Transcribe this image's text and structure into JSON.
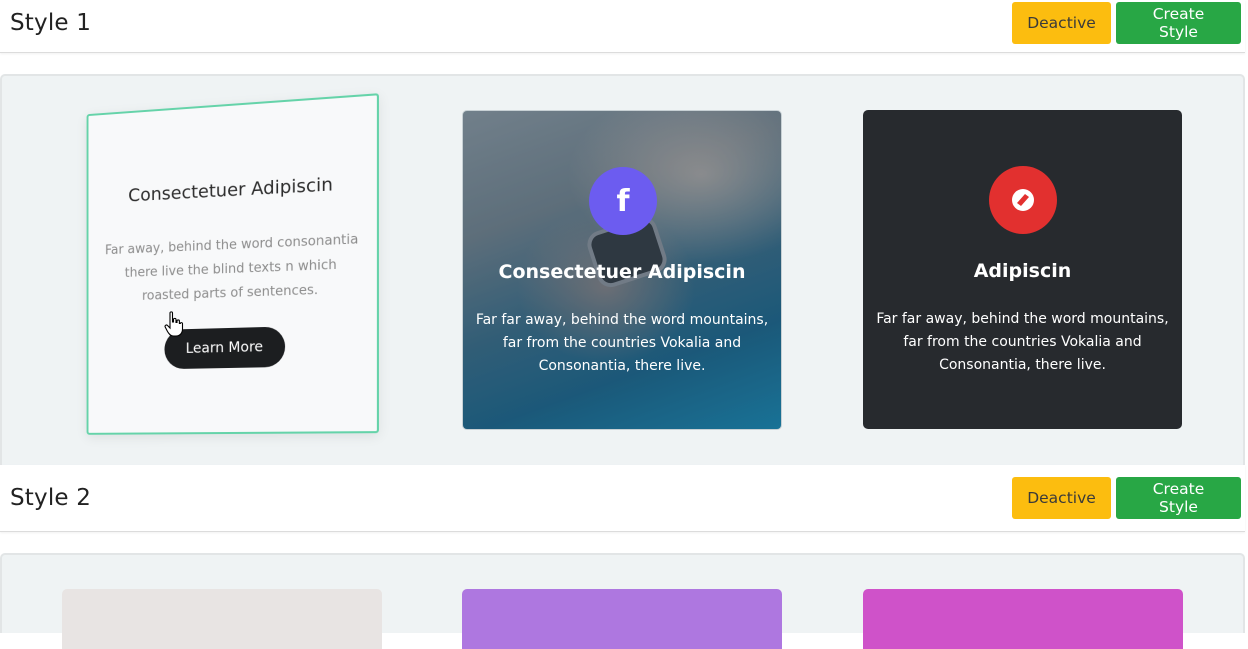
{
  "sections": [
    {
      "title": "Style 1",
      "deactive_label": "Deactive",
      "create_label": "Create Style"
    },
    {
      "title": "Style 2",
      "deactive_label": "Deactive",
      "create_label": "Create Style"
    }
  ],
  "style1_cards": [
    {
      "title": "Consectetuer Adipiscin",
      "text": "Far away, behind the word consonantia there live the blind texts n which roasted parts of sentences.",
      "button_label": "Learn More",
      "border_color": "#65d3a9"
    },
    {
      "title": "Consectetuer Adipiscin",
      "text": "Far far away, behind the word mountains, far from the countries Vokalia and Consonantia, there live.",
      "icon": "facebook-icon",
      "icon_glyph": "f",
      "icon_color": "#6c5cf0"
    },
    {
      "title": "Adipiscin",
      "text": "Far far away, behind the word mountains, far from the countries Vokalia and Consonantia, there live.",
      "icon": "behance-icon",
      "icon_color": "#e2302f",
      "background": "#272a2e"
    }
  ],
  "style2_cards": [
    {
      "color": "#e8e4e3"
    },
    {
      "color": "#ae77e0"
    },
    {
      "color": "#cf52c9"
    }
  ],
  "colors": {
    "warning": "#fcbd0f",
    "success": "#28a745",
    "panel_bg": "#eff3f4"
  }
}
